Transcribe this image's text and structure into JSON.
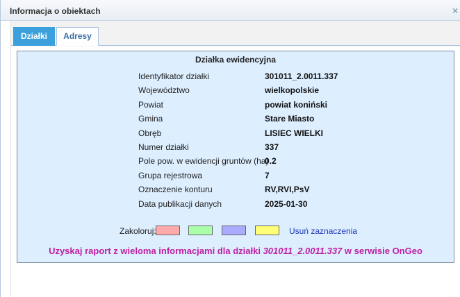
{
  "window": {
    "title": "Informacja o obiektach",
    "close_glyph": "×",
    "close_icon": "close-icon"
  },
  "tabs": [
    {
      "label": "Działki",
      "active": true
    },
    {
      "label": "Adresy",
      "active": false
    }
  ],
  "section": {
    "title": "Działka ewidencyjna",
    "rows": [
      {
        "label": "Identyfikator działki",
        "value": "301011_2.0011.337"
      },
      {
        "label": "Województwo",
        "value": "wielkopolskie"
      },
      {
        "label": "Powiat",
        "value": "powiat koniński"
      },
      {
        "label": "Gmina",
        "value": "Stare Miasto"
      },
      {
        "label": "Obręb",
        "value": "LISIEC WIELKI"
      },
      {
        "label": "Numer działki",
        "value": "337"
      },
      {
        "label": "Pole pow. w ewidencji gruntów (ha)",
        "value": "0.2"
      },
      {
        "label": "Grupa rejestrowa",
        "value": "7"
      },
      {
        "label": "Oznaczenie konturu",
        "value": "RV,RVI,PsV"
      },
      {
        "label": "Data publikacji danych",
        "value": "2025-01-30"
      }
    ]
  },
  "colorize": {
    "label": "Zakoloruj:",
    "swatches": [
      "#ffaaaa",
      "#aaffaa",
      "#aaaaff",
      "#ffff77"
    ],
    "clear_label": "Usuń zaznaczenia"
  },
  "report": {
    "prefix": "Uzyskaj raport z wieloma informacjami dla działki ",
    "parcel_id": "301011_2.0011.337",
    "suffix": " w serwisie OnGeo"
  },
  "colors": {
    "tab_active_bg": "#3ca0dc",
    "box_bg": "#ddeeff",
    "report_text": "#c020a0",
    "link": "#1a36b5"
  }
}
